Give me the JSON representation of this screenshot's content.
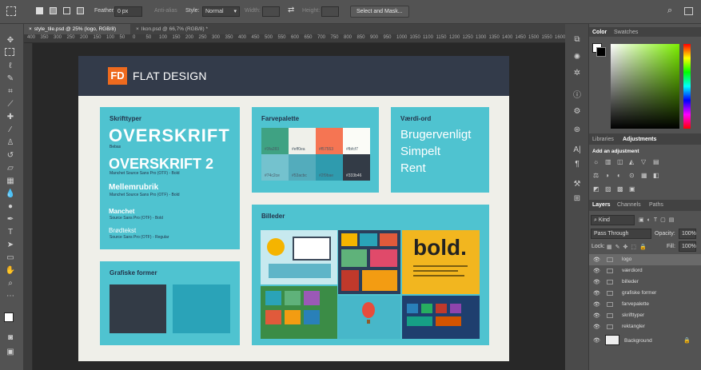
{
  "options_bar": {
    "feather_label": "Feather:",
    "feather_value": "0 px",
    "antialias_label": "Anti-alias",
    "style_label": "Style:",
    "style_value": "Normal",
    "width_label": "Width:",
    "height_label": "Height:",
    "select_mask_label": "Select and Mask..."
  },
  "tabs": [
    {
      "label": "style_tile.psd @ 25% (logo, RGB/8)",
      "close": "×"
    },
    {
      "label": "Ikon.psd @ 66,7% (RGB/8) *",
      "close": "×"
    }
  ],
  "ruler": [
    "400",
    "350",
    "300",
    "250",
    "200",
    "150",
    "100",
    "50",
    "0",
    "50",
    "100",
    "150",
    "200",
    "250",
    "300",
    "350",
    "400",
    "450",
    "500",
    "550",
    "600",
    "650",
    "700",
    "750",
    "800",
    "850",
    "900",
    "950",
    "1000",
    "1050",
    "1100",
    "1150",
    "1200",
    "1250",
    "1300",
    "1350",
    "1400",
    "1450",
    "1500",
    "1550",
    "1600"
  ],
  "document": {
    "logo_mark": "FD",
    "logo_text": "FLAT DESIGN",
    "typography": {
      "title": "Skrifttyper",
      "h1": "OVERSKRIFT",
      "h1_font": "Bebas",
      "h2": "OVERSKRIFT 2",
      "h2_font": "Manchet Source Sans Pro (OTF) - Bold",
      "h3": "Mellemrubrik",
      "h3_font": "Manchet Source Sans Pro (OTF) - Bold",
      "h4": "Manchet",
      "h4_font": "Source Sans Pro (OTF) - Bold",
      "body": "Brødtekst",
      "body_font": "Source Sans Pro (OTF) - Regular"
    },
    "palette": {
      "title": "Farvepalette",
      "colors": [
        {
          "hex": "#3fa283",
          "label": "#3fa283"
        },
        {
          "hex": "#eff0ea",
          "label": "#eff0ea"
        },
        {
          "hex": "#f57553",
          "label": "#f57553"
        },
        {
          "hex": "#fbfcf7",
          "label": "#fbfcf7"
        },
        {
          "hex": "#74c2ce",
          "label": "#74c2ce"
        },
        {
          "hex": "#53acbc",
          "label": "#53acbc"
        },
        {
          "hex": "#2f9bae",
          "label": "#2f9bae"
        },
        {
          "hex": "#333b46",
          "label": "#333b46"
        }
      ]
    },
    "values": {
      "title": "Værdi-ord",
      "words": [
        "Brugervenligt",
        "Simpelt",
        "Rent"
      ]
    },
    "shapes": {
      "title": "Grafiske former"
    },
    "images": {
      "title": "Billeder",
      "bold_text": "bold."
    }
  },
  "panels": {
    "color_tab": "Color",
    "swatches_tab": "Swatches",
    "libraries_tab": "Libraries",
    "adjustments_tab": "Adjustments",
    "add_adjustment": "Add an adjustment",
    "layers_tab": "Layers",
    "channels_tab": "Channels",
    "paths_tab": "Paths",
    "kind_value": "Kind",
    "blend_value": "Pass Through",
    "opacity_label": "Opacity:",
    "opacity_value": "100%",
    "lock_label": "Lock:",
    "fill_label": "Fill:",
    "fill_value": "100%",
    "layers": [
      "logo",
      "værdiord",
      "billeder",
      "grafiske former",
      "farvepalette",
      "skrifttyper",
      "rektangler"
    ],
    "background_layer": "Background"
  }
}
